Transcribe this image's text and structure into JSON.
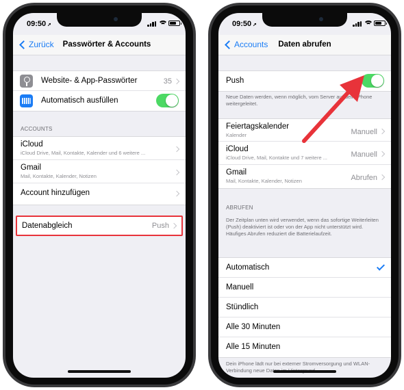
{
  "colors": {
    "accent": "#1a7cf5",
    "toggle_on": "#4cd964",
    "highlight": "#e8333a"
  },
  "left_screen": {
    "status": {
      "time": "09:50",
      "location_arrow": "➚"
    },
    "nav": {
      "back_label": "Zurück",
      "title": "Passwörter & Accounts"
    },
    "rows_top": [
      {
        "label": "Website- & App-Passwörter",
        "value": "35",
        "icon": "key-icon"
      },
      {
        "label": "Automatisch ausfüllen",
        "toggle": true,
        "icon": "keyboard-icon"
      }
    ],
    "accounts_header": "ACCOUNTS",
    "accounts": [
      {
        "label": "iCloud",
        "sub": "iCloud Drive, Mail, Kontakte, Kalender und 6 weitere ..."
      },
      {
        "label": "Gmail",
        "sub": "Mail, Kontakte, Kalender, Notizen"
      },
      {
        "label": "Account hinzufügen"
      }
    ],
    "fetch_row": {
      "label": "Datenabgleich",
      "value": "Push"
    }
  },
  "right_screen": {
    "status": {
      "time": "09:50",
      "location_arrow": "➚"
    },
    "nav": {
      "back_label": "Accounts",
      "title": "Daten abrufen"
    },
    "push": {
      "label": "Push",
      "toggle": true
    },
    "push_footnote": "Neue Daten werden, wenn möglich, vom Server auf dein iPhone weitergeleitet.",
    "accounts": [
      {
        "label": "Feiertagskalender",
        "sub": "Kalender",
        "value": "Manuell"
      },
      {
        "label": "iCloud",
        "sub": "iCloud Drive, Mail, Kontakte und 7 weitere ...",
        "value": "Manuell"
      },
      {
        "label": "Gmail",
        "sub": "Mail, Kontakte, Kalender, Notizen",
        "value": "Abrufen"
      }
    ],
    "fetch_header": "ABRUFEN",
    "fetch_footnote": "Der Zeitplan unten wird verwendet, wenn das sofortige Weiterleiten (Push) deaktiviert ist oder von der App nicht unterstützt wird. Häufiges Abrufen reduziert die Batterielaufzeit.",
    "schedule": [
      {
        "label": "Automatisch",
        "selected": true
      },
      {
        "label": "Manuell"
      },
      {
        "label": "Stündlich"
      },
      {
        "label": "Alle 30 Minuten"
      },
      {
        "label": "Alle 15 Minuten"
      }
    ],
    "bottom_footnote": "Dein iPhone lädt nur bei externer Stromversorgung und WLAN-Verbindung neue Daten im Hintergrund."
  }
}
